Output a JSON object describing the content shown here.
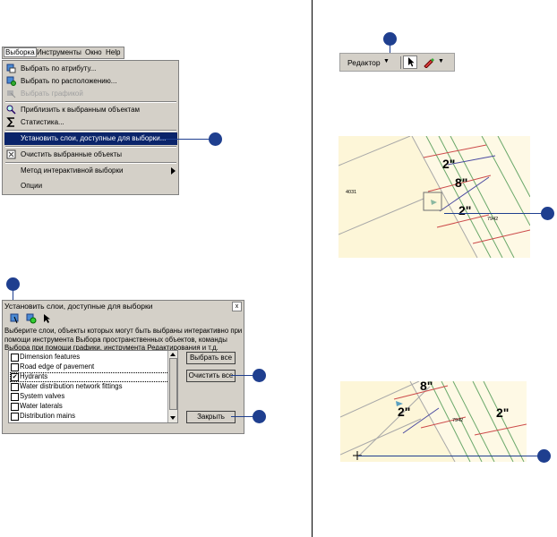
{
  "menubar": {
    "items": [
      "Выборка",
      "Инструменты",
      "Окно",
      "Help"
    ]
  },
  "menu": {
    "items": [
      {
        "label": "Выбрать по атрибуту...",
        "icon": "select-by-attribute-icon",
        "state": "normal"
      },
      {
        "label": "Выбрать по расположению...",
        "icon": "select-by-location-icon",
        "state": "normal"
      },
      {
        "label": "Выбрать графикой",
        "icon": "select-by-graphics-icon",
        "state": "disabled"
      },
      {
        "label": "Приблизить к выбранным объектам",
        "icon": "zoom-to-selected-icon",
        "state": "normal"
      },
      {
        "label": "Статистика...",
        "icon": "sigma-icon",
        "state": "normal"
      },
      {
        "label": "Установить слои, доступные для выборки...",
        "icon": "",
        "state": "selected"
      },
      {
        "label": "Очистить выбранные объекты",
        "icon": "clear-selection-icon",
        "state": "normal"
      },
      {
        "label": "Метод интерактивной выборки",
        "icon": "",
        "state": "submenu"
      },
      {
        "label": "Опции",
        "icon": "",
        "state": "normal"
      }
    ]
  },
  "dialog": {
    "title": "Установить слои, доступные для выборки",
    "close": "x",
    "description": "Выберите слои, объекты которых могут быть выбраны интерактивно при помощи инструмента Выбора пространственных объектов, команды Выбора при помощи графики, инструмента Редактирования и т.д.",
    "layers": [
      {
        "label": "Dimension features",
        "checked": false
      },
      {
        "label": "Road  edge of pavement",
        "checked": false
      },
      {
        "label": "Hydrants",
        "checked": true
      },
      {
        "label": "Water distribution network fittings",
        "checked": false
      },
      {
        "label": "System valves",
        "checked": false
      },
      {
        "label": "Water laterals",
        "checked": false
      },
      {
        "label": "Distribution mains",
        "checked": false
      }
    ],
    "check_mark": "✔",
    "buttons": {
      "select_all": "Выбрать все",
      "clear_all": "Очистить все",
      "close": "Закрыть"
    }
  },
  "toolbar": {
    "editor_label": "Редактор",
    "dropdown_arrow": "▼"
  },
  "map1": {
    "parcel_label": "4031",
    "parcel_label_2": "7942",
    "dim_labels": [
      "2\"",
      "8\"",
      "2\""
    ]
  },
  "map2": {
    "parcel_label": "7942",
    "dim_labels": [
      "8\"",
      "2\"",
      "2\""
    ]
  },
  "colors": {
    "callout": "#1f3f8f",
    "menu_bg": "#d4d0c8",
    "highlight": "#0a246a",
    "map_bg": "#fdf6d8"
  }
}
